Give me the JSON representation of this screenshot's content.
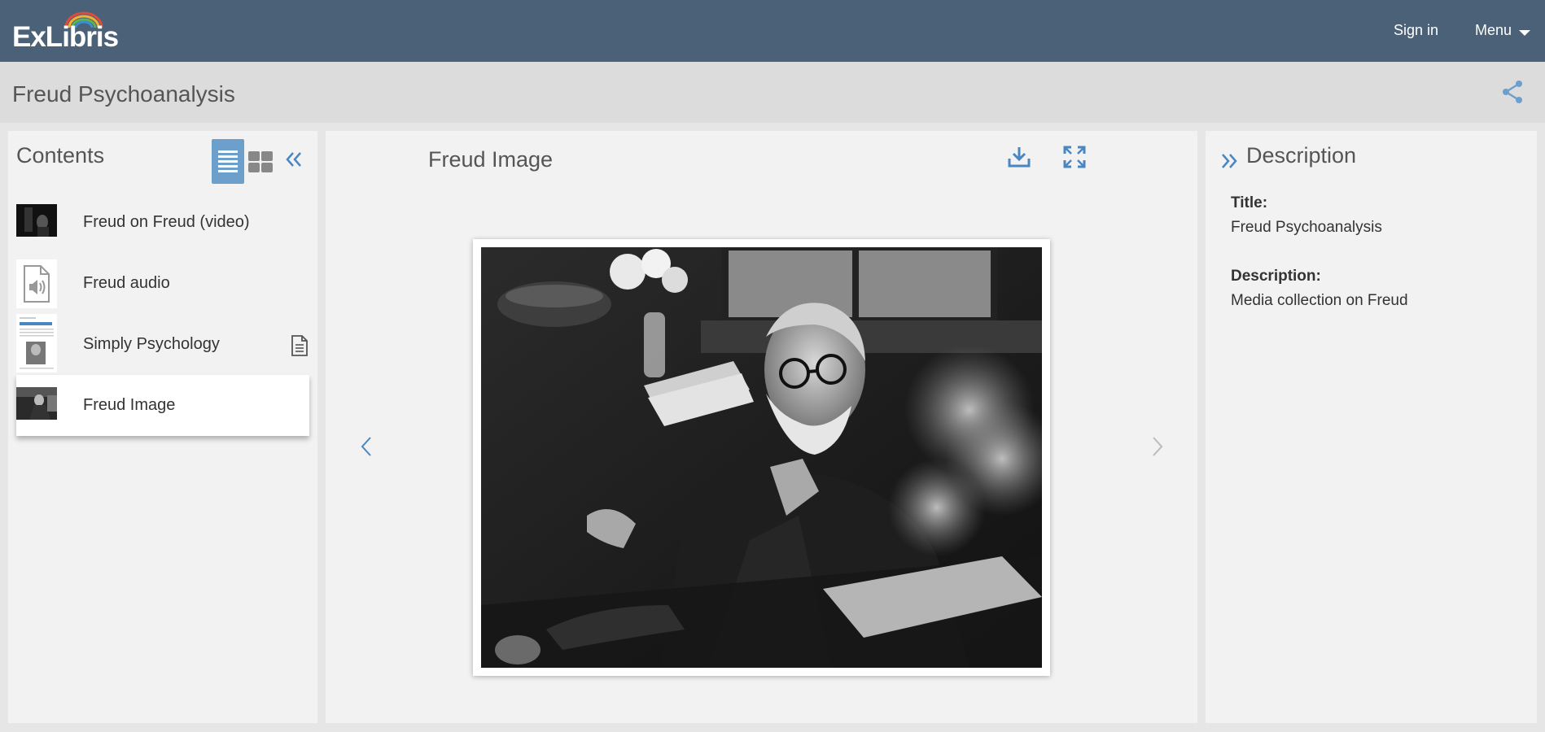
{
  "header": {
    "logo_text": "ExLibris",
    "sign_in_label": "Sign in",
    "menu_label": "Menu"
  },
  "title_bar": {
    "title": "Freud Psychoanalysis"
  },
  "contents": {
    "title": "Contents",
    "items": [
      {
        "label": "Freud on Freud (video)",
        "thumb": "video-thumbnail"
      },
      {
        "label": "Freud audio",
        "thumb": "audio-file-icon"
      },
      {
        "label": "Simply Psychology",
        "thumb": "document-thumbnail",
        "type_icon": "document-icon"
      },
      {
        "label": "Freud Image",
        "thumb": "image-thumbnail",
        "selected": true
      }
    ]
  },
  "viewer": {
    "title": "Freud Image"
  },
  "description": {
    "title": "Description",
    "fields": [
      {
        "label": "Title:",
        "value": "Freud Psychoanalysis"
      },
      {
        "label": "Description:",
        "value": "Media collection on Freud"
      }
    ]
  },
  "colors": {
    "topbar": "#4a6178",
    "accent": "#6d9fcc",
    "titlebar": "#dcdcdc",
    "panel": "#f2f2f2"
  }
}
